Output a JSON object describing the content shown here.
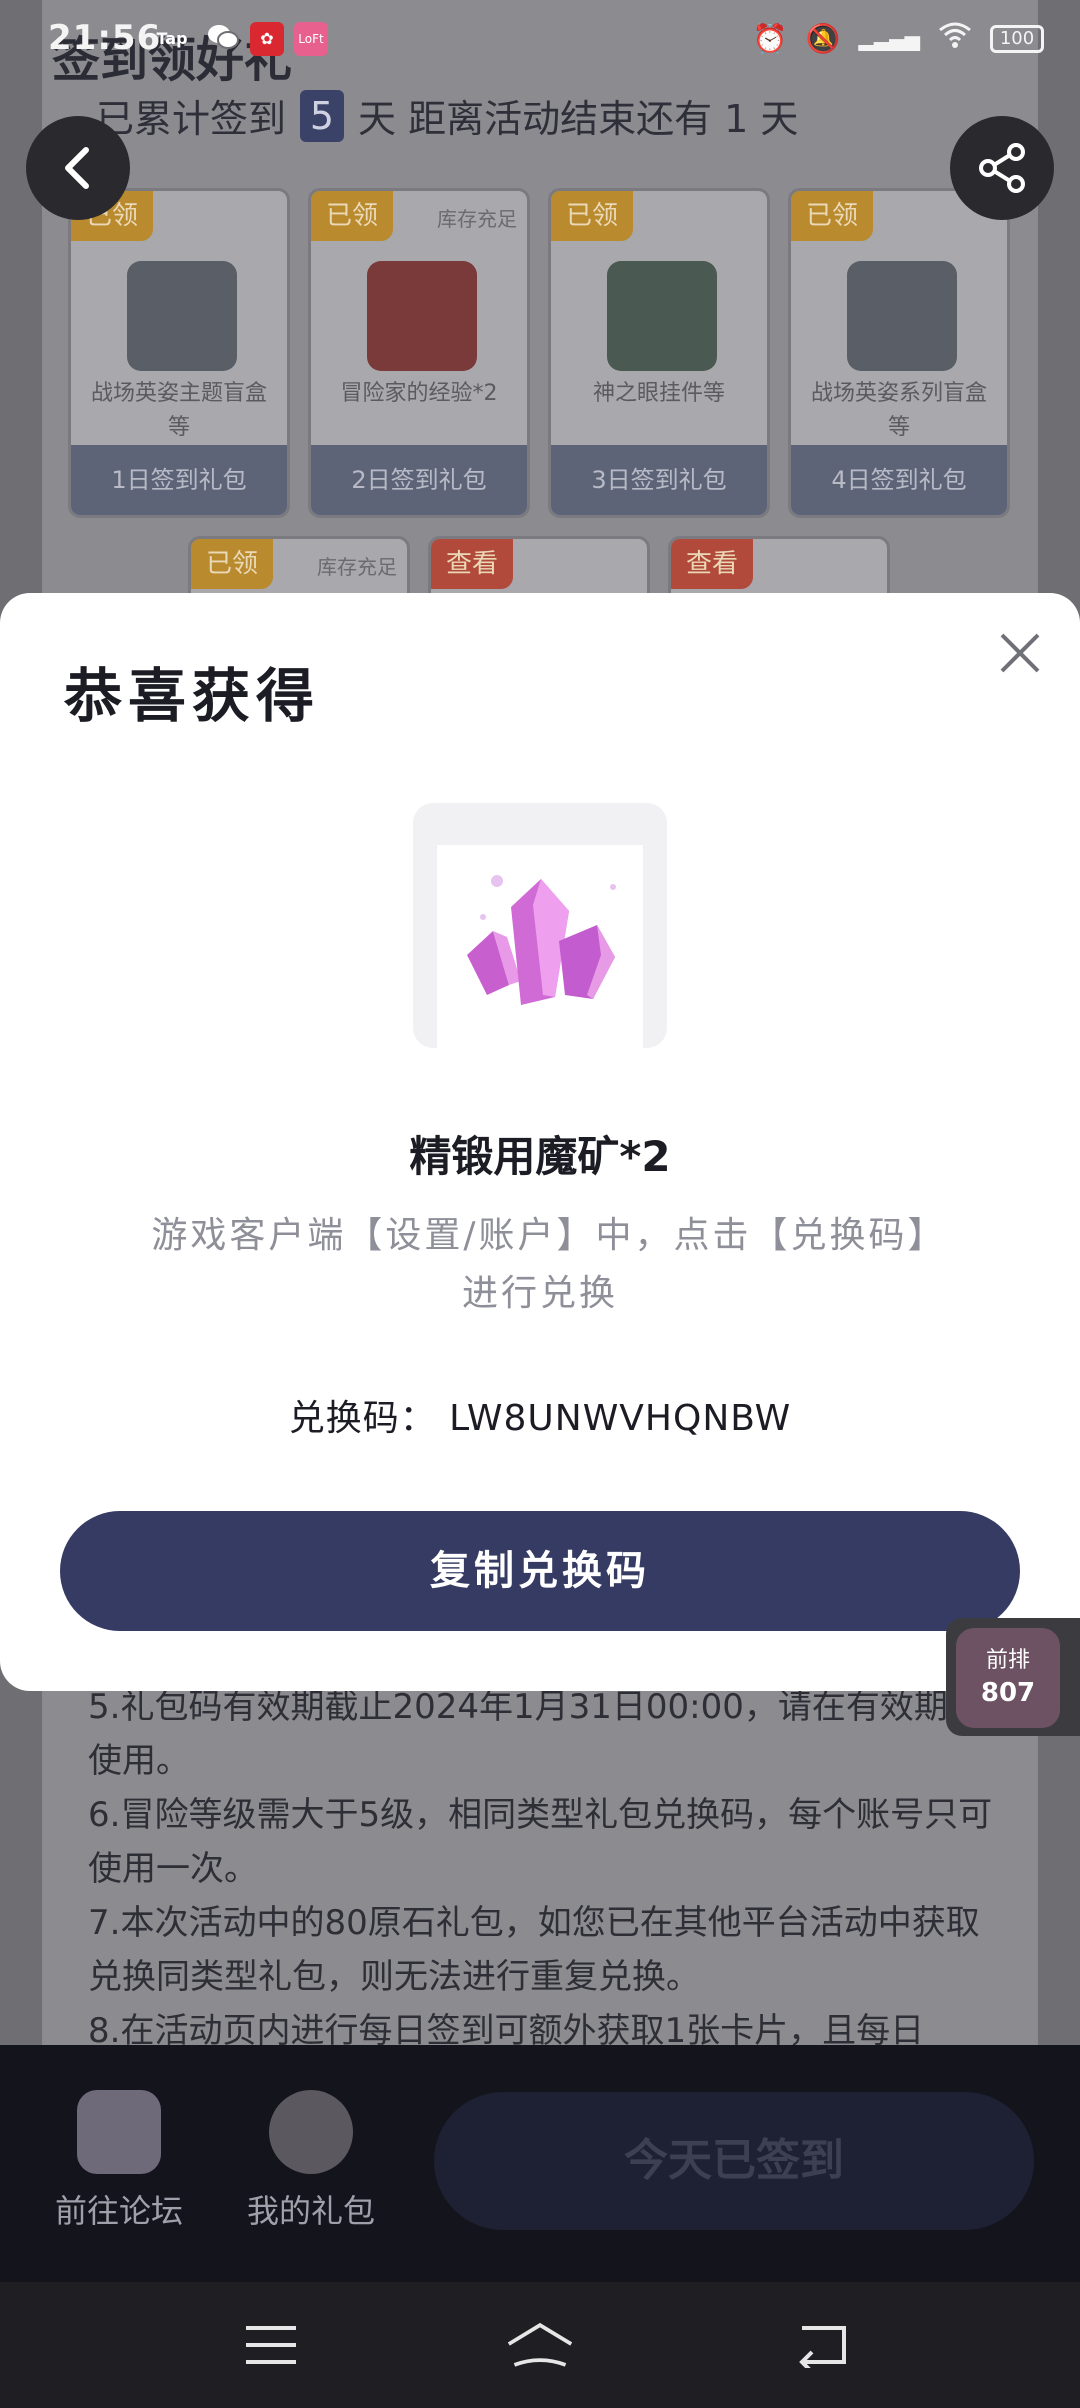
{
  "status_bar": {
    "time": "21:56",
    "battery": "100",
    "apps": [
      "Tap",
      "WeChat",
      "Weibo",
      "Lofter"
    ]
  },
  "background": {
    "title": "签到领好礼",
    "signed_prefix": "已累计签到",
    "signed_days": "5",
    "signed_suffix": "天  距离活动结束还有 1 天",
    "cards": [
      {
        "tag": "已领",
        "stock": "",
        "name": "战场英姿主题盲盒等",
        "footer": "1日签到礼包"
      },
      {
        "tag": "已领",
        "stock": "库存充足",
        "name": "冒险家的经验*2",
        "footer": "2日签到礼包"
      },
      {
        "tag": "已领",
        "stock": "",
        "name": "神之眼挂件等",
        "footer": "3日签到礼包"
      },
      {
        "tag": "已领",
        "stock": "",
        "name": "战场英姿系列盲盒等",
        "footer": "4日签到礼包"
      }
    ],
    "row2_tags": [
      {
        "tag": "已领",
        "stock": "库存充足"
      },
      {
        "tag": "查看",
        "stock": ""
      },
      {
        "tag": "查看",
        "stock": ""
      }
    ],
    "rules": [
      "5.礼包码有效期截止2024年1月31日00:00，请在有效期内使用。",
      "6.冒险等级需大于5级，相同类型礼包兑换码，每个账号只可使用一次。",
      "7.本次活动中的80原石礼包，如您已在其他平台活动中获取兑换同类型礼包，则无法进行重复兑换。",
      "8.在活动页内进行每日签到可额外获取1张卡片，且每日"
    ]
  },
  "bottom": {
    "forum_label": "前往论坛",
    "gifts_label": "我的礼包",
    "signed_button": "今天已签到"
  },
  "modal": {
    "title": "恭喜获得",
    "prize_name": "精锻用魔矿*2",
    "description": "游戏客户端【设置/账户】中，点击【兑换码】进行兑换",
    "code_label": "兑换码：",
    "code_value": "LW8UNWVHQNBW",
    "copy_button": "复制兑换码"
  },
  "rank_widget": {
    "label": "前排",
    "value": "807"
  },
  "colors": {
    "primary": "#353b63",
    "tag_gold": "#b98a2e",
    "crystal": "#d46bd8"
  }
}
